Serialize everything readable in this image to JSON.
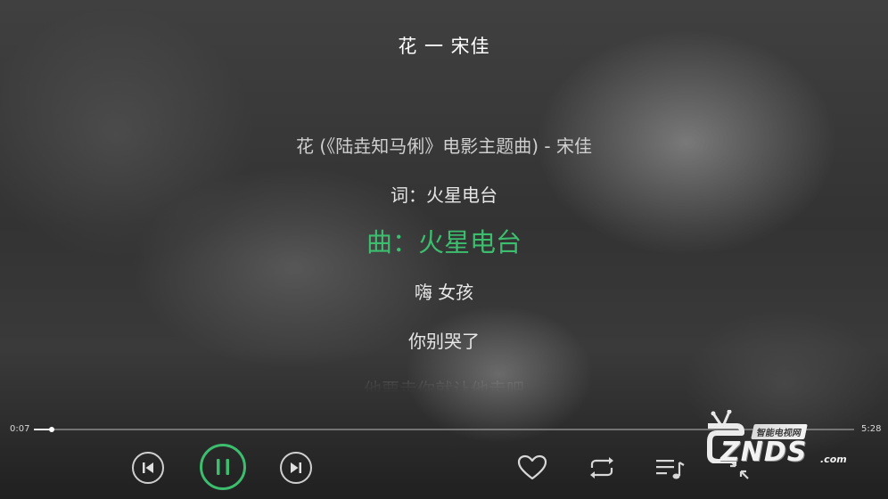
{
  "player": {
    "title": "花 一 宋佳"
  },
  "lyrics": {
    "lines": [
      "花 (《陆垚知马俐》电影主题曲) - 宋佳",
      "词：火星电台",
      "曲：火星电台",
      "嗨 女孩",
      "你别哭了",
      "他要走你就让他走吧"
    ],
    "active_index": 2
  },
  "progress": {
    "elapsed": "0:07",
    "total": "5:28",
    "fraction": 0.022
  },
  "controls": {
    "previous_icon": "skip-previous-icon",
    "pause_icon": "pause-icon",
    "next_icon": "skip-next-icon",
    "favorite_icon": "heart-outline-icon",
    "repeat_icon": "repeat-icon",
    "playlist_icon": "playlist-icon",
    "collapse_icon": "collapse-arrows-icon"
  },
  "colors": {
    "accent": "#3dbd6e",
    "text": "#ffffff"
  },
  "watermark": {
    "banner": "智能电视网",
    "logo": "ZNDS",
    "suffix": ".com",
    "icon": "tv-antenna-icon"
  }
}
